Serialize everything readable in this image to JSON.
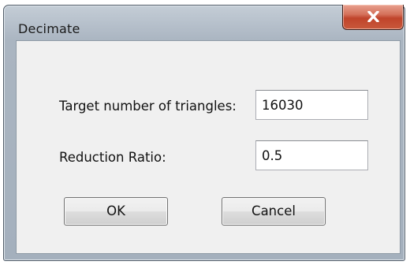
{
  "window": {
    "title": "Decimate",
    "close_icon": "close-x-icon"
  },
  "form": {
    "target_triangles_label": "Target number of triangles:",
    "target_triangles_value": "16030",
    "reduction_ratio_label": "Reduction Ratio:",
    "reduction_ratio_value": "0.5"
  },
  "buttons": {
    "ok_label": "OK",
    "cancel_label": "Cancel"
  },
  "colors": {
    "close_button": "#c8583b",
    "client_background": "#f0f0f0",
    "frame": "#aab5c1"
  }
}
